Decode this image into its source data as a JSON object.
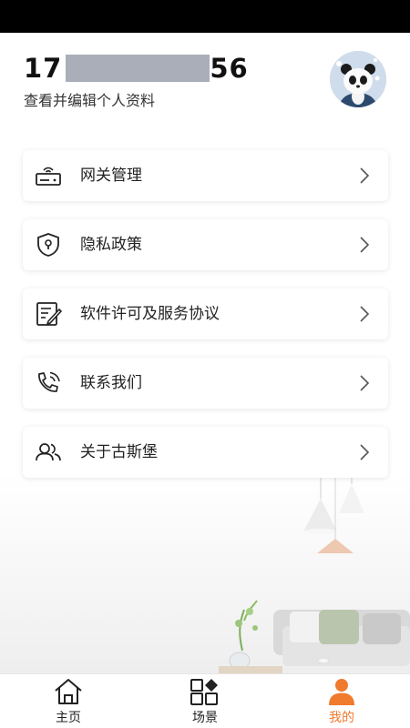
{
  "profile": {
    "phone_prefix": "17",
    "phone_suffix": "56",
    "edit_link": "查看并编辑个人资料"
  },
  "menu": {
    "items": [
      {
        "label": "网关管理",
        "icon": "router-icon"
      },
      {
        "label": "隐私政策",
        "icon": "privacy-shield-icon"
      },
      {
        "label": "软件许可及服务协议",
        "icon": "license-document-icon"
      },
      {
        "label": "联系我们",
        "icon": "phone-call-icon"
      },
      {
        "label": "关于古斯堡",
        "icon": "users-icon"
      }
    ]
  },
  "tabbar": {
    "tabs": [
      {
        "label": "主页",
        "icon": "home-icon"
      },
      {
        "label": "场景",
        "icon": "scene-grid-icon"
      },
      {
        "label": "我的",
        "icon": "person-icon",
        "active": true
      }
    ]
  },
  "colors": {
    "accent": "#f07a2e",
    "mask": "#a9aeb8",
    "status_bar": "#000000"
  }
}
